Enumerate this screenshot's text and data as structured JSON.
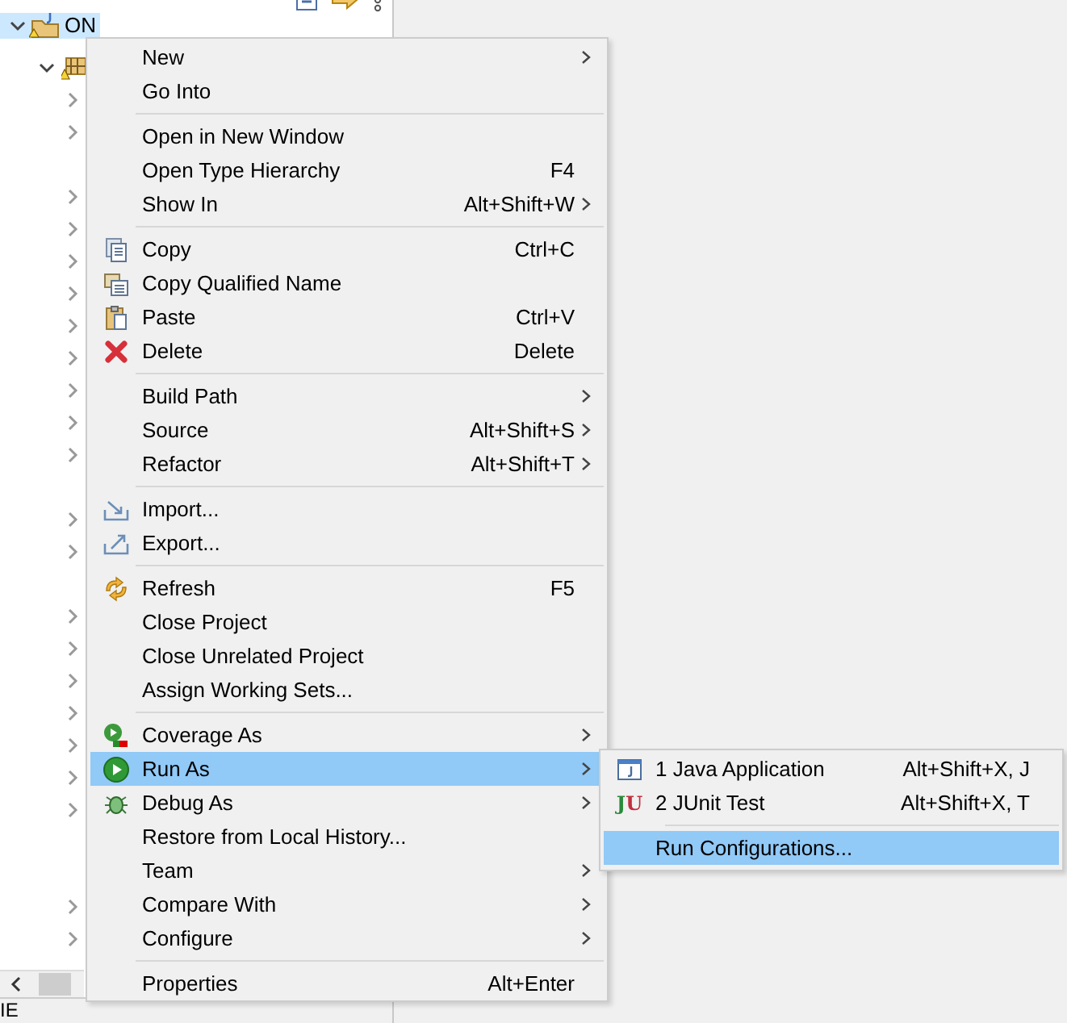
{
  "tree": {
    "nodes": [
      {
        "label": "ON",
        "expanded": true,
        "selected": true,
        "children": [
          {
            "expanded": true,
            "children": [
              {
                "has_children": true
              },
              {
                "has_children": true
              },
              {
                "has_children": false
              },
              {
                "has_children": true
              },
              {
                "has_children": true
              },
              {
                "has_children": true
              },
              {
                "has_children": true
              },
              {
                "has_children": true
              },
              {
                "has_children": true
              },
              {
                "has_children": true
              },
              {
                "has_children": true
              },
              {
                "has_children": true
              },
              {
                "has_children": false
              },
              {
                "has_children": true
              },
              {
                "has_children": true
              },
              {
                "has_children": false
              },
              {
                "has_children": true
              },
              {
                "has_children": true
              },
              {
                "has_children": true
              },
              {
                "has_children": true
              },
              {
                "has_children": true
              },
              {
                "has_children": true
              },
              {
                "has_children": true
              },
              {
                "has_children": false
              },
              {
                "has_children": false
              },
              {
                "has_children": true
              },
              {
                "has_children": true
              }
            ]
          }
        ]
      }
    ]
  },
  "status_text": "IE",
  "context_menu": {
    "sections": [
      [
        {
          "label": "New",
          "submenu": true,
          "selected": false
        },
        {
          "label": "Go Into",
          "submenu": false,
          "selected": false
        }
      ],
      [
        {
          "label": "Open in New Window",
          "submenu": false,
          "selected": false
        },
        {
          "label": "Open Type Hierarchy",
          "shortcut": "F4",
          "submenu": false,
          "selected": false
        },
        {
          "label": "Show In",
          "shortcut": "Alt+Shift+W",
          "submenu": true,
          "selected": false
        }
      ],
      [
        {
          "label": "Copy",
          "shortcut": "Ctrl+C",
          "submenu": false,
          "selected": false
        },
        {
          "label": "Copy Qualified Name",
          "submenu": false,
          "selected": false
        },
        {
          "label": "Paste",
          "shortcut": "Ctrl+V",
          "submenu": false,
          "selected": false
        },
        {
          "label": "Delete",
          "shortcut": "Delete",
          "submenu": false,
          "selected": false
        }
      ],
      [
        {
          "label": "Build Path",
          "submenu": true,
          "selected": false
        },
        {
          "label": "Source",
          "shortcut": "Alt+Shift+S",
          "submenu": true,
          "selected": false
        },
        {
          "label": "Refactor",
          "shortcut": "Alt+Shift+T",
          "submenu": true,
          "selected": false
        }
      ],
      [
        {
          "label": "Import...",
          "submenu": false,
          "selected": false
        },
        {
          "label": "Export...",
          "submenu": false,
          "selected": false
        }
      ],
      [
        {
          "label": "Refresh",
          "shortcut": "F5",
          "submenu": false,
          "selected": false
        },
        {
          "label": "Close Project",
          "submenu": false,
          "selected": false
        },
        {
          "label": "Close Unrelated Project",
          "submenu": false,
          "selected": false
        },
        {
          "label": "Assign Working Sets...",
          "submenu": false,
          "selected": false
        }
      ],
      [
        {
          "label": "Coverage As",
          "submenu": true,
          "selected": false
        },
        {
          "label": "Run As",
          "submenu": true,
          "selected": true
        },
        {
          "label": "Debug As",
          "submenu": true,
          "selected": false
        },
        {
          "label": "Restore from Local History...",
          "submenu": false,
          "selected": false
        },
        {
          "label": "Team",
          "submenu": true,
          "selected": false
        },
        {
          "label": "Compare With",
          "submenu": true,
          "selected": false
        },
        {
          "label": "Configure",
          "submenu": true,
          "selected": false
        }
      ],
      [
        {
          "label": "Properties",
          "shortcut": "Alt+Enter",
          "submenu": false,
          "selected": false
        }
      ]
    ]
  },
  "submenu": {
    "sections": [
      [
        {
          "label": "1 Java Application",
          "shortcut": "Alt+Shift+X, J",
          "selected": false
        },
        {
          "label": "2 JUnit Test",
          "shortcut": "Alt+Shift+X, T",
          "selected": false,
          "icon_letters": [
            "J",
            "U"
          ]
        }
      ],
      [
        {
          "label": "Run Configurations...",
          "selected": true
        }
      ]
    ]
  }
}
